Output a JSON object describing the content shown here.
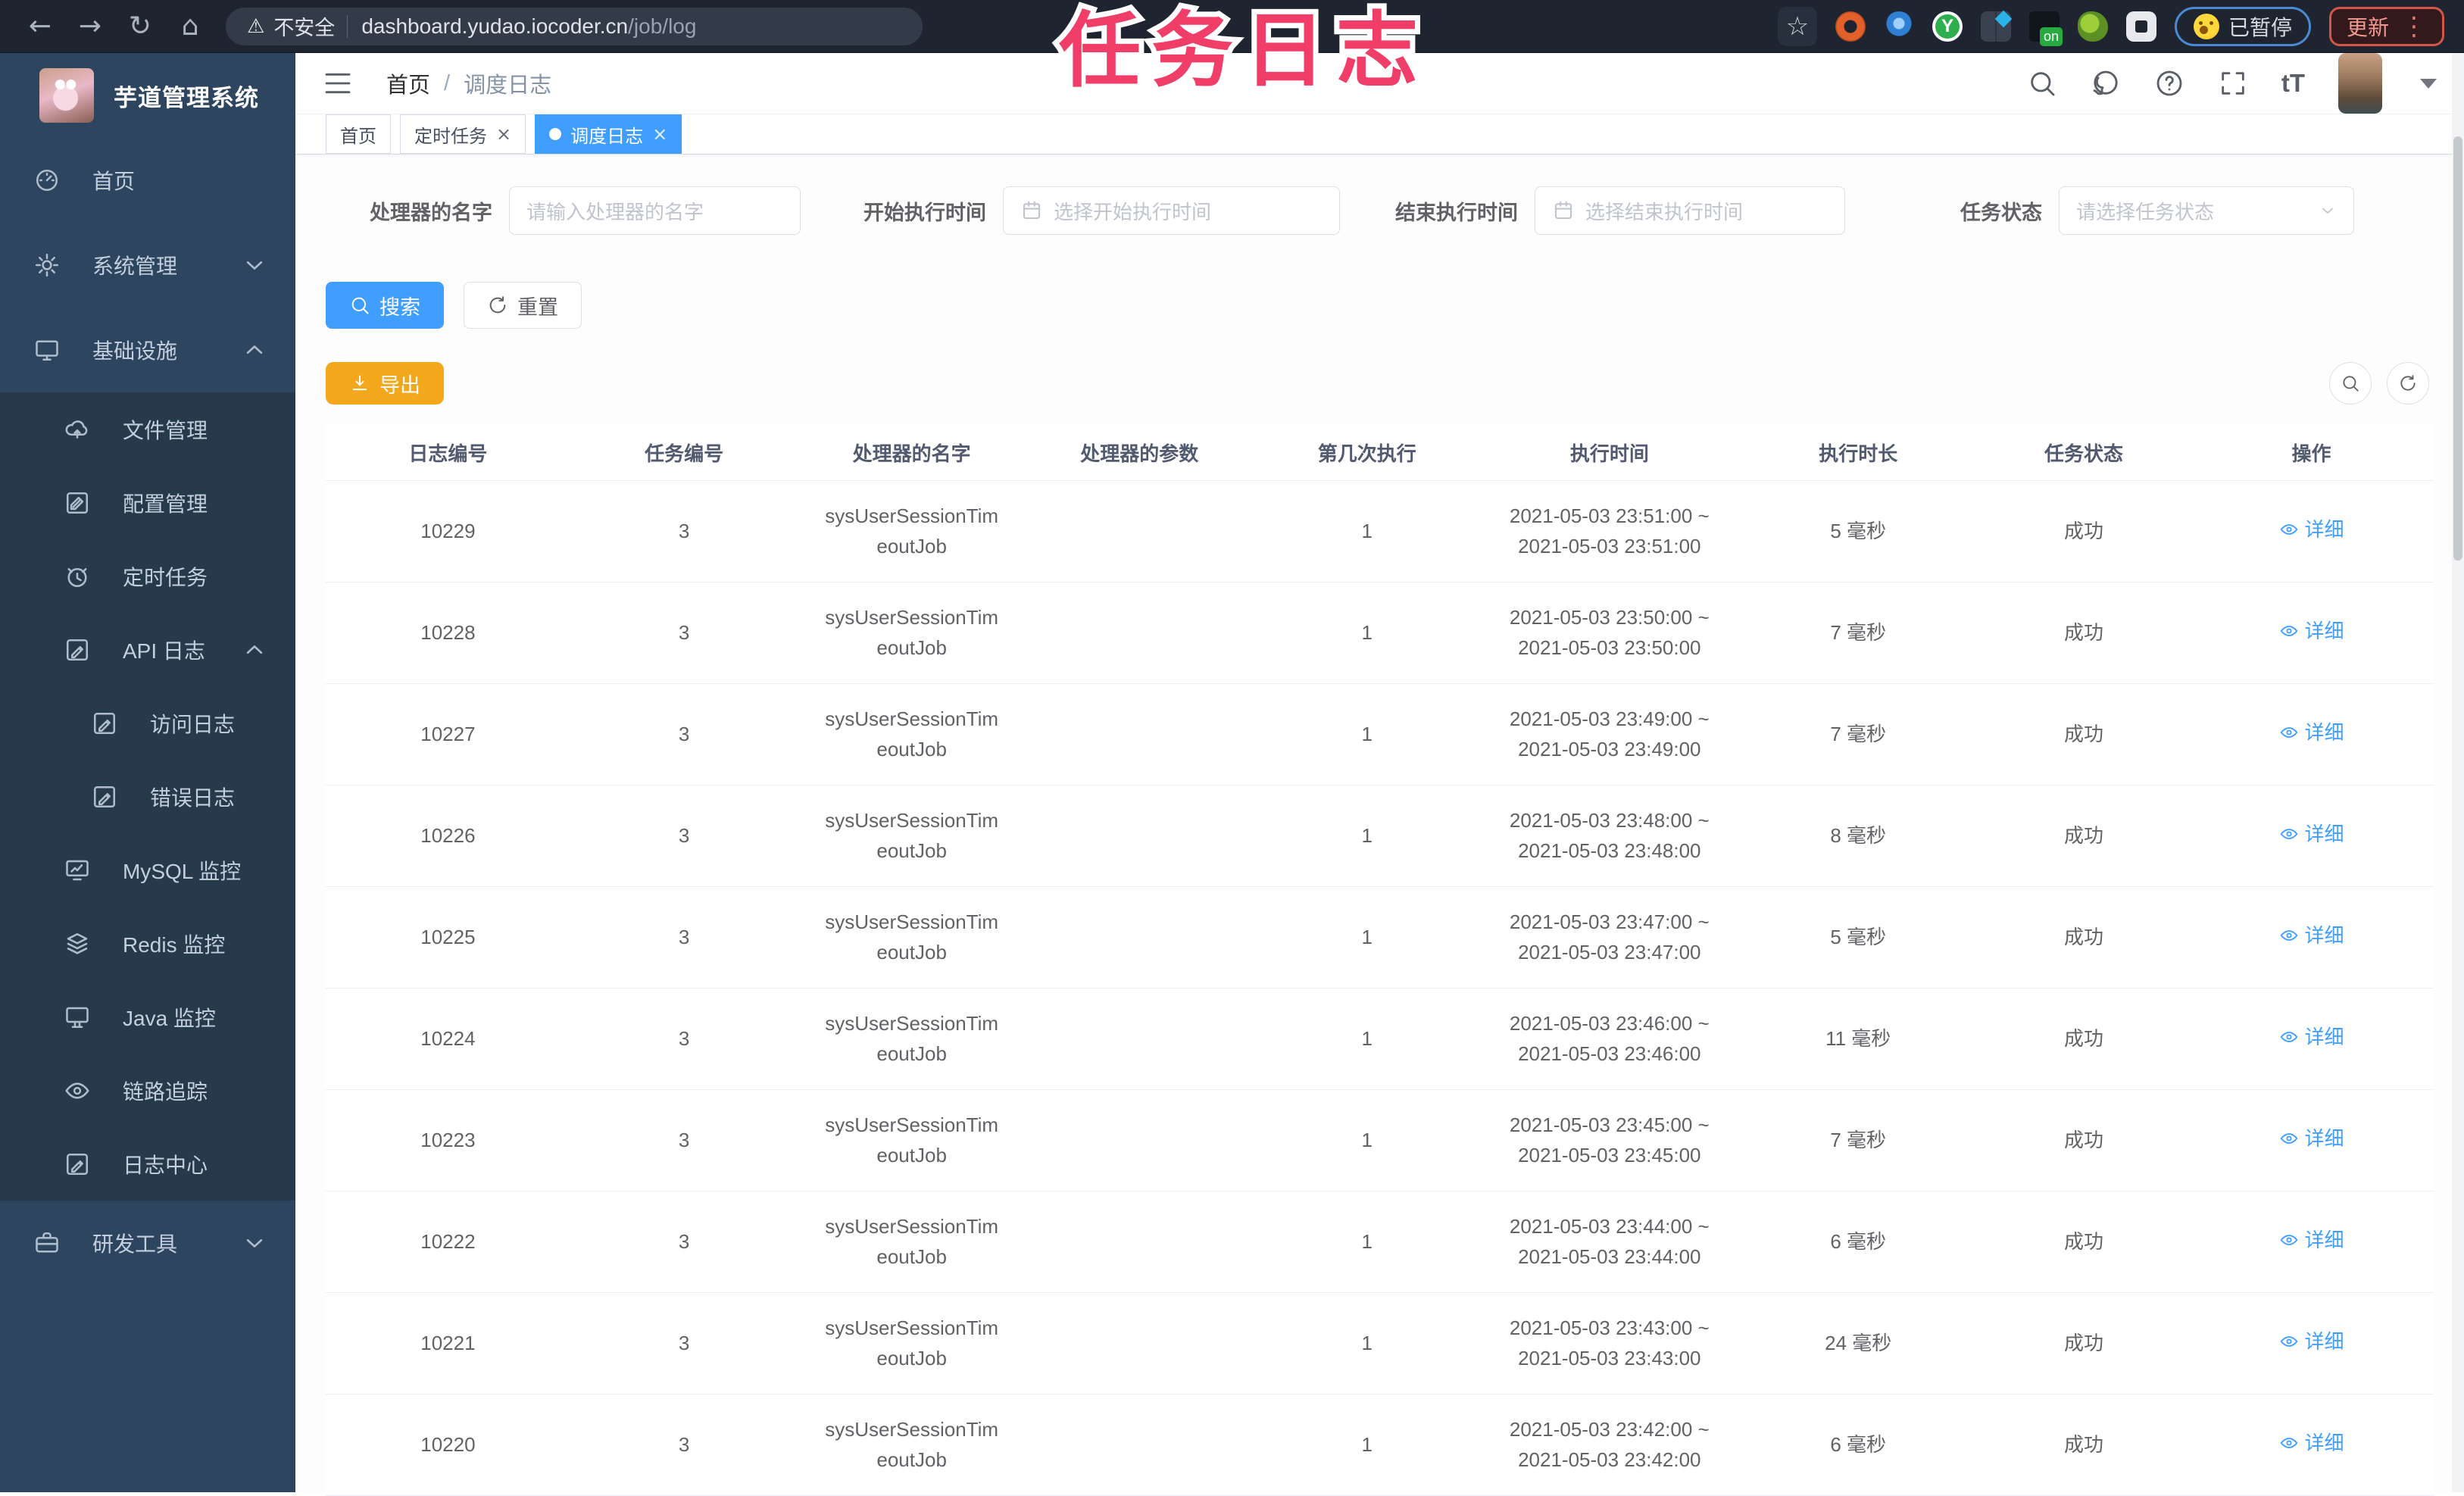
{
  "colors": {
    "accent": "#409eff",
    "warning_button": "#f3a81c",
    "tab_active": "#409eff",
    "annotation_pink": "#f03e68",
    "sidebar_bg": "#2e4560",
    "sidebar_submenu_bg": "#263a4c"
  },
  "annotation": {
    "text": "任务日志"
  },
  "browser": {
    "security_label": "不安全",
    "url_host": "dashboard.yudao.iocoder.cn",
    "url_path": "/job/log",
    "paused_label": "已暂停",
    "update_label": "更新",
    "extensions": [
      "ext-orange-circle",
      "ext-blue-bulb",
      "ext-green-y",
      "ext-grid-diamond",
      "ext-on-badge",
      "ext-green-leaf",
      "extensions-puzzle"
    ]
  },
  "sidebar": {
    "title": "芋道管理系统",
    "items": [
      {
        "icon": "dashboard",
        "label": "首页",
        "level": 1,
        "chevron": null
      },
      {
        "icon": "gear",
        "label": "系统管理",
        "level": 1,
        "chevron": "down"
      },
      {
        "icon": "monitor",
        "label": "基础设施",
        "level": 1,
        "chevron": "up"
      },
      {
        "icon": "cloud-upload",
        "label": "文件管理",
        "level": 2,
        "chevron": null
      },
      {
        "icon": "edit",
        "label": "配置管理",
        "level": 2,
        "chevron": null
      },
      {
        "icon": "history",
        "label": "定时任务",
        "level": 2,
        "chevron": null
      },
      {
        "icon": "log",
        "label": "API 日志",
        "level": 2,
        "chevron": "up"
      },
      {
        "icon": "log",
        "label": "访问日志",
        "level": 3,
        "chevron": null
      },
      {
        "icon": "log",
        "label": "错误日志",
        "level": 3,
        "chevron": null
      },
      {
        "icon": "mysql",
        "label": "MySQL 监控",
        "level": 2,
        "chevron": null
      },
      {
        "icon": "redis",
        "label": "Redis 监控",
        "level": 2,
        "chevron": null
      },
      {
        "icon": "java",
        "label": "Java 监控",
        "level": 2,
        "chevron": null
      },
      {
        "icon": "eye",
        "label": "链路追踪",
        "level": 2,
        "chevron": null
      },
      {
        "icon": "log",
        "label": "日志中心",
        "level": 2,
        "chevron": null
      },
      {
        "icon": "toolbox",
        "label": "研发工具",
        "level": 1,
        "chevron": "down"
      }
    ]
  },
  "header": {
    "breadcrumb_home": "首页",
    "breadcrumb_current": "调度日志"
  },
  "tabs": [
    {
      "label": "首页",
      "active": false,
      "closable": false
    },
    {
      "label": "定时任务",
      "active": false,
      "closable": true
    },
    {
      "label": "调度日志",
      "active": true,
      "closable": true
    }
  ],
  "filters": [
    {
      "label": "处理器的名字",
      "placeholder": "请输入处理器的名字",
      "type": "text",
      "label_w": 220,
      "input_w": 385,
      "ml": 0
    },
    {
      "label": "开始执行时间",
      "placeholder": "选择开始执行时间",
      "type": "date",
      "label_w": 180,
      "input_w": 445,
      "ml": 65
    },
    {
      "label": "结束执行时间",
      "placeholder": "选择结束执行时间",
      "type": "date",
      "label_w": 175,
      "input_w": 410,
      "ml": 60
    },
    {
      "label": "任务状态",
      "placeholder": "请选择任务状态",
      "type": "select",
      "label_w": 110,
      "input_w": 390,
      "ml": 150
    }
  ],
  "actions": {
    "search": "搜索",
    "reset": "重置",
    "export": "导出"
  },
  "table": {
    "columns": [
      "日志编号",
      "任务编号",
      "处理器的名字",
      "处理器的参数",
      "第几次执行",
      "执行时间",
      "执行时长",
      "任务状态",
      "操作"
    ],
    "col_widths": [
      11.6,
      10.8,
      10.8,
      10.8,
      10.8,
      12.2,
      11.4,
      10.0,
      11.6
    ],
    "detail_label": "详细",
    "rows": [
      {
        "log_id": "10229",
        "task_id": "3",
        "handler_line1": "sysUserSessionTim",
        "handler_line2": "eoutJob",
        "params": "",
        "count": "1",
        "time_line1": "2021-05-03 23:51:00 ~",
        "time_line2": "2021-05-03 23:51:00",
        "duration": "5 毫秒",
        "status": "成功"
      },
      {
        "log_id": "10228",
        "task_id": "3",
        "handler_line1": "sysUserSessionTim",
        "handler_line2": "eoutJob",
        "params": "",
        "count": "1",
        "time_line1": "2021-05-03 23:50:00 ~",
        "time_line2": "2021-05-03 23:50:00",
        "duration": "7 毫秒",
        "status": "成功"
      },
      {
        "log_id": "10227",
        "task_id": "3",
        "handler_line1": "sysUserSessionTim",
        "handler_line2": "eoutJob",
        "params": "",
        "count": "1",
        "time_line1": "2021-05-03 23:49:00 ~",
        "time_line2": "2021-05-03 23:49:00",
        "duration": "7 毫秒",
        "status": "成功"
      },
      {
        "log_id": "10226",
        "task_id": "3",
        "handler_line1": "sysUserSessionTim",
        "handler_line2": "eoutJob",
        "params": "",
        "count": "1",
        "time_line1": "2021-05-03 23:48:00 ~",
        "time_line2": "2021-05-03 23:48:00",
        "duration": "8 毫秒",
        "status": "成功"
      },
      {
        "log_id": "10225",
        "task_id": "3",
        "handler_line1": "sysUserSessionTim",
        "handler_line2": "eoutJob",
        "params": "",
        "count": "1",
        "time_line1": "2021-05-03 23:47:00 ~",
        "time_line2": "2021-05-03 23:47:00",
        "duration": "5 毫秒",
        "status": "成功"
      },
      {
        "log_id": "10224",
        "task_id": "3",
        "handler_line1": "sysUserSessionTim",
        "handler_line2": "eoutJob",
        "params": "",
        "count": "1",
        "time_line1": "2021-05-03 23:46:00 ~",
        "time_line2": "2021-05-03 23:46:00",
        "duration": "11 毫秒",
        "status": "成功"
      },
      {
        "log_id": "10223",
        "task_id": "3",
        "handler_line1": "sysUserSessionTim",
        "handler_line2": "eoutJob",
        "params": "",
        "count": "1",
        "time_line1": "2021-05-03 23:45:00 ~",
        "time_line2": "2021-05-03 23:45:00",
        "duration": "7 毫秒",
        "status": "成功"
      },
      {
        "log_id": "10222",
        "task_id": "3",
        "handler_line1": "sysUserSessionTim",
        "handler_line2": "eoutJob",
        "params": "",
        "count": "1",
        "time_line1": "2021-05-03 23:44:00 ~",
        "time_line2": "2021-05-03 23:44:00",
        "duration": "6 毫秒",
        "status": "成功"
      },
      {
        "log_id": "10221",
        "task_id": "3",
        "handler_line1": "sysUserSessionTim",
        "handler_line2": "eoutJob",
        "params": "",
        "count": "1",
        "time_line1": "2021-05-03 23:43:00 ~",
        "time_line2": "2021-05-03 23:43:00",
        "duration": "24 毫秒",
        "status": "成功"
      },
      {
        "log_id": "10220",
        "task_id": "3",
        "handler_line1": "sysUserSessionTim",
        "handler_line2": "eoutJob",
        "params": "",
        "count": "1",
        "time_line1": "2021-05-03 23:42:00 ~",
        "time_line2": "2021-05-03 23:42:00",
        "duration": "6 毫秒",
        "status": "成功"
      }
    ]
  }
}
